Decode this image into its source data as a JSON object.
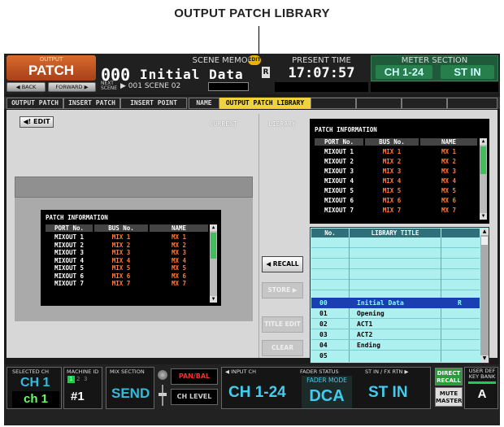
{
  "callout": "OUTPUT PATCH LIBRARY",
  "topbar": {
    "output_small": "OUTPUT",
    "output_big": "PATCH",
    "back_label": "◀ BACK",
    "forward_label": "FORWARD ▶",
    "scene_memory_label": "SCENE MEMORY",
    "edit_badge": "EDIT",
    "scene_number": "000",
    "scene_title": "Initial Data",
    "r_flag": "R",
    "next_label_1": "NEXT",
    "next_label_2": "SCENE",
    "next_scene": "▶ 001 SCENE 02",
    "present_time_label": "PRESENT TIME",
    "present_time": "17:07:57",
    "meter_section_label": "METER SECTION",
    "meter_ch": "CH 1-24",
    "meter_st": "ST IN"
  },
  "tabs": [
    {
      "label": "OUTPUT PATCH",
      "active": false
    },
    {
      "label": "INSERT PATCH",
      "active": false
    },
    {
      "label": "INSERT POINT",
      "active": false
    },
    {
      "label": "NAME",
      "active": false
    },
    {
      "label": "OUTPUT PATCH LIBRARY",
      "active": true
    }
  ],
  "panel": {
    "edit_label": "◀! EDIT",
    "current_label": "CURRENT",
    "library_label": "LIBRARY"
  },
  "current_patch": {
    "title": "PATCH INFORMATION",
    "headers": [
      "PORT No.",
      "BUS No.",
      "NAME"
    ],
    "rows": [
      [
        "MIXOUT 1",
        "MIX 1",
        "MX 1"
      ],
      [
        "MIXOUT 2",
        "MIX 2",
        "MX 2"
      ],
      [
        "MIXOUT 3",
        "MIX 3",
        "MX 3"
      ],
      [
        "MIXOUT 4",
        "MIX 4",
        "MX 4"
      ],
      [
        "MIXOUT 5",
        "MIX 5",
        "MX 5"
      ],
      [
        "MIXOUT 6",
        "MIX 6",
        "MX 6"
      ],
      [
        "MIXOUT 7",
        "MIX 7",
        "MX 7"
      ]
    ]
  },
  "library_patch": {
    "title": "PATCH INFORMATION",
    "headers": [
      "PORT No.",
      "BUS No.",
      "NAME"
    ],
    "rows": [
      [
        "MIXOUT 1",
        "MIX 1",
        "MX 1"
      ],
      [
        "MIXOUT 2",
        "MIX 2",
        "MX 2"
      ],
      [
        "MIXOUT 3",
        "MIX 3",
        "MX 3"
      ],
      [
        "MIXOUT 4",
        "MIX 4",
        "MX 4"
      ],
      [
        "MIXOUT 5",
        "MIX 5",
        "MX 5"
      ],
      [
        "MIXOUT 6",
        "MIX 6",
        "MX 6"
      ],
      [
        "MIXOUT 7",
        "MIX 7",
        "MX 7"
      ]
    ]
  },
  "buttons": {
    "recall": "◀ RECALL",
    "store": "STORE ▶",
    "title_edit": "TITLE EDIT",
    "clear": "CLEAR"
  },
  "library_list": {
    "headers": [
      "No.",
      "LIBRARY TITLE",
      ""
    ],
    "rows": [
      {
        "no": "00",
        "title": "Initial Data",
        "flag": "R",
        "selected": true
      },
      {
        "no": "01",
        "title": "Opening",
        "flag": "",
        "selected": false
      },
      {
        "no": "02",
        "title": "ACT1",
        "flag": "",
        "selected": false
      },
      {
        "no": "03",
        "title": "ACT2",
        "flag": "",
        "selected": false
      },
      {
        "no": "04",
        "title": "Ending",
        "flag": "",
        "selected": false
      },
      {
        "no": "05",
        "title": "",
        "flag": "",
        "selected": false
      }
    ]
  },
  "bottombar": {
    "selected_ch_label": "SELECTED CH",
    "selected_ch": "CH 1",
    "selected_ch_name": "ch 1",
    "machine_id_label": "MACHINE ID",
    "machine_id_1": "1",
    "machine_id_2": "2",
    "machine_id_3": "3",
    "machine_id": "#1",
    "mix_section_label": "MIX SECTION",
    "mix_section": "SEND",
    "pan_bal": "PAN/BAL",
    "ch_level": "CH LEVEL",
    "input_ch_label": "◀ INPUT CH",
    "input_ch": "CH 1-24",
    "fader_status_label": "FADER STATUS",
    "fader_mode": "FADER MODE",
    "fader_dca": "DCA",
    "st_in_label": "ST IN / FX RTN ▶",
    "st_in": "ST IN",
    "direct_recall": "DIRECT RECALL",
    "mute_master": "MUTE MASTER",
    "user_def_label": "USER DEF KEY BANK",
    "user_def_bank": "A"
  }
}
